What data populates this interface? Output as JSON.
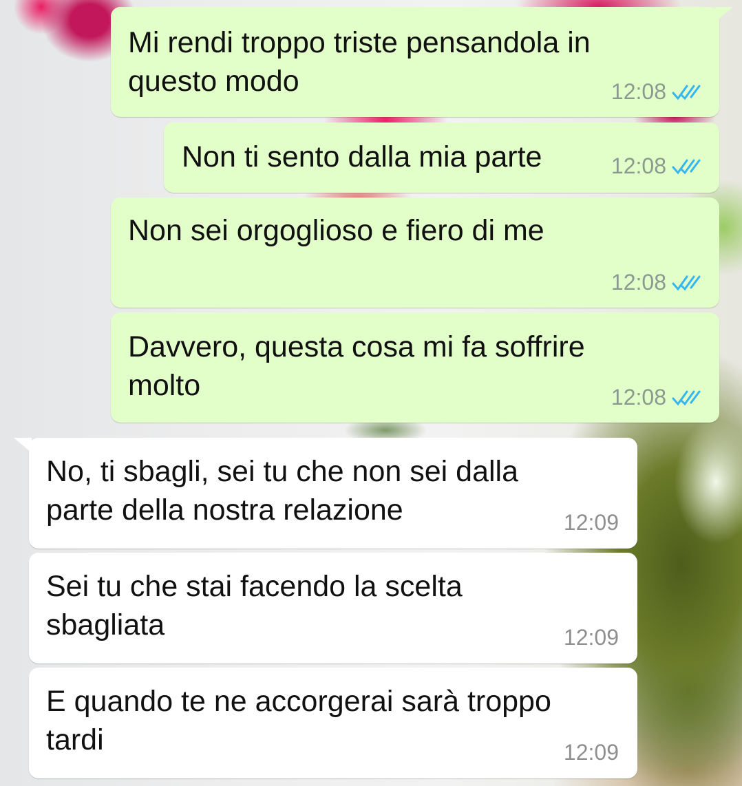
{
  "colors": {
    "outgoing_bubble": "#e2fec9",
    "incoming_bubble": "#ffffff",
    "read_ticks": "#34b7f1",
    "timestamp": "#8a9a90"
  },
  "messages": [
    {
      "direction": "outgoing",
      "text": "Mi rendi troppo triste pensandola in\nquesto modo",
      "time": "12:08",
      "status": "read",
      "status_icon": "double-check-icon"
    },
    {
      "direction": "outgoing",
      "text": "Non ti sento dalla mia parte",
      "time": "12:08",
      "status": "read",
      "status_icon": "double-check-icon"
    },
    {
      "direction": "outgoing",
      "text": "Non sei orgoglioso e fiero di me",
      "time": "12:08",
      "status": "read",
      "status_icon": "double-check-icon"
    },
    {
      "direction": "outgoing",
      "text": "Davvero, questa cosa mi fa soffrire\nmolto",
      "time": "12:08",
      "status": "read",
      "status_icon": "double-check-icon"
    },
    {
      "direction": "incoming",
      "text": "No, ti sbagli, sei tu che non sei dalla\nparte della nostra relazione",
      "time": "12:09"
    },
    {
      "direction": "incoming",
      "text": "Sei tu che stai facendo la scelta\nsbagliata",
      "time": "12:09"
    },
    {
      "direction": "incoming",
      "text": "E quando te ne accorgerai sarà troppo\ntardi",
      "time": "12:09"
    }
  ]
}
